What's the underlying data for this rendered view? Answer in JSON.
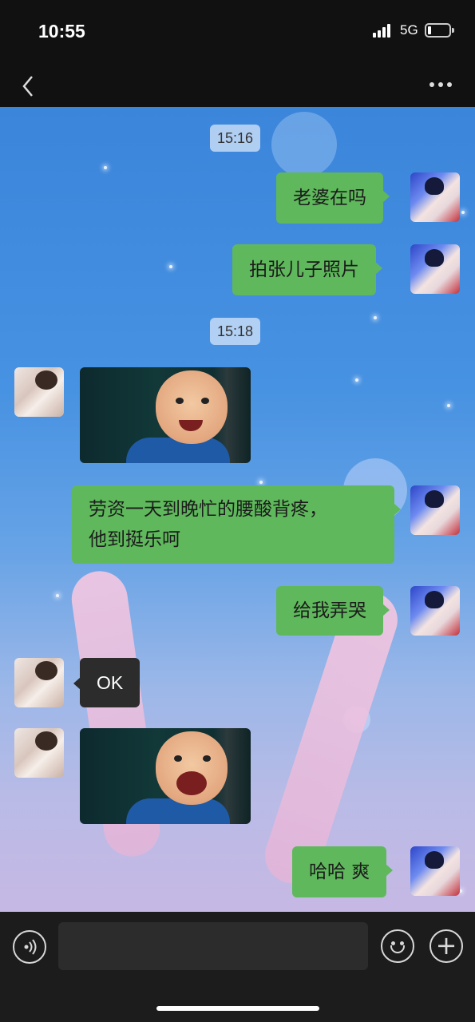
{
  "status_bar": {
    "time": "10:55",
    "network": "5G"
  },
  "header": {
    "back_icon": "chevron-left-icon",
    "more_icon": "more-dots-icon"
  },
  "chat": {
    "timestamps": [
      "15:16",
      "15:18"
    ],
    "messages": [
      {
        "sender": "me",
        "type": "text",
        "text": "老婆在吗"
      },
      {
        "sender": "me",
        "type": "text",
        "text": "拍张儿子照片"
      },
      {
        "sender": "other",
        "type": "image",
        "description": "baby-photo-smiling"
      },
      {
        "sender": "me",
        "type": "text",
        "line1": "劳资一天到晚忙的腰酸背疼，",
        "line2": "他到挺乐呵"
      },
      {
        "sender": "me",
        "type": "text",
        "text": "给我弄哭"
      },
      {
        "sender": "other",
        "type": "text",
        "text": "OK"
      },
      {
        "sender": "other",
        "type": "image",
        "description": "baby-photo-crying"
      },
      {
        "sender": "me",
        "type": "text",
        "text": "哈哈 爽"
      }
    ]
  },
  "input_bar": {
    "voice_icon": "voice-icon",
    "input_value": "",
    "emoji_icon": "emoji-icon",
    "plus_icon": "plus-icon"
  },
  "colors": {
    "my_bubble": "#5fb85c",
    "other_bubble": "#2c2c2c",
    "header_bg": "#111111"
  }
}
